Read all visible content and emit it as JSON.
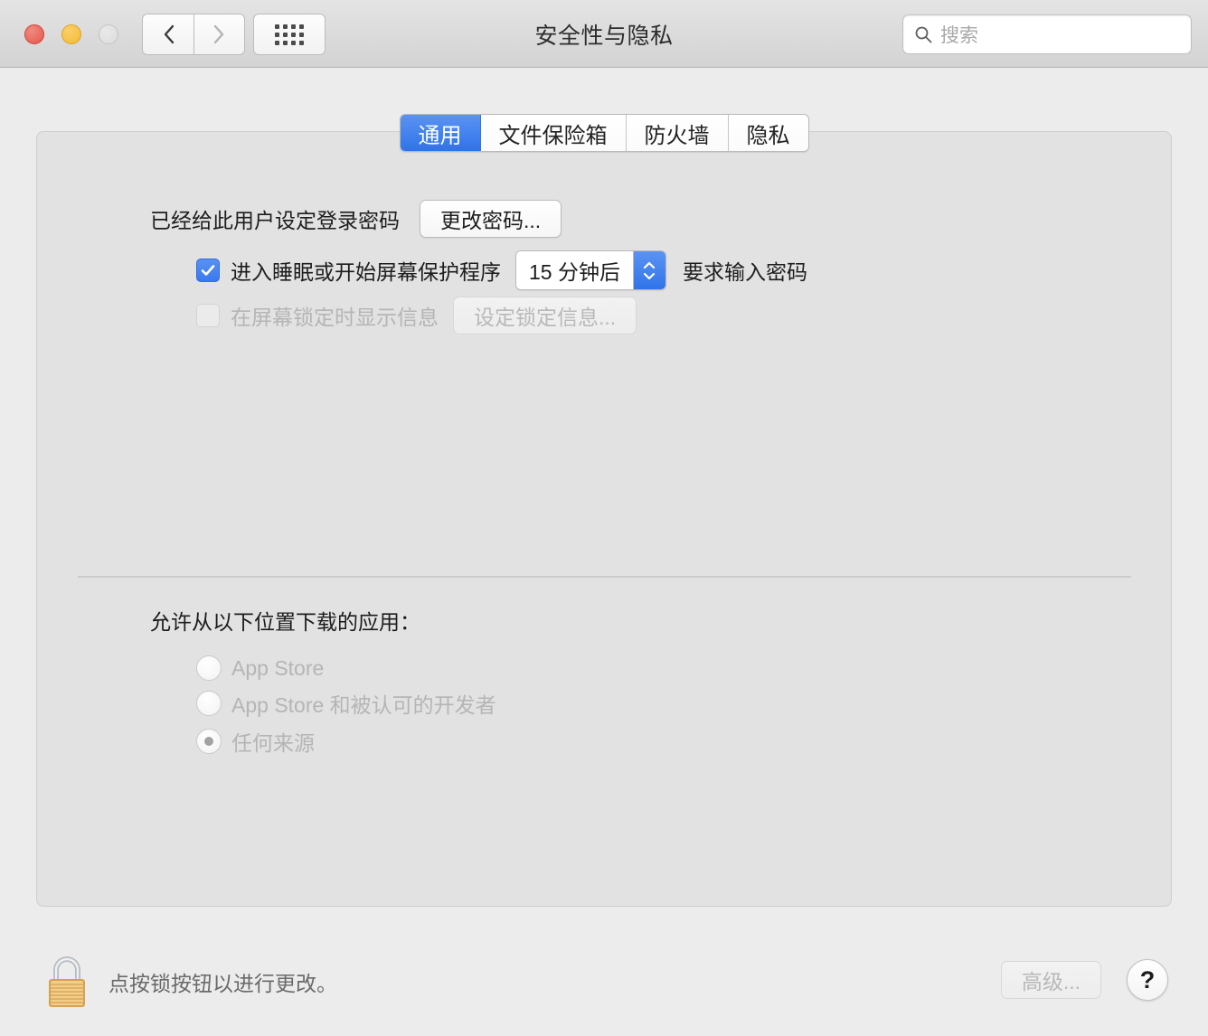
{
  "window": {
    "title": "安全性与隐私",
    "traffic_lights": [
      "close",
      "minimize",
      "zoom"
    ]
  },
  "toolbar": {
    "back_icon": "chevron-left-icon",
    "forward_icon": "chevron-right-icon",
    "show_all_icon": "grid-dots-icon",
    "search": {
      "placeholder": "搜索",
      "value": "",
      "icon": "search-icon"
    }
  },
  "tabs": [
    {
      "label": "通用",
      "active": true
    },
    {
      "label": "文件保险箱",
      "active": false
    },
    {
      "label": "防火墙",
      "active": false
    },
    {
      "label": "隐私",
      "active": false
    }
  ],
  "general": {
    "login_password_label": "已经给此用户设定登录密码",
    "change_password_button": "更改密码...",
    "require_password": {
      "checked": true,
      "prefix_label": "进入睡眠或开始屏幕保护程序",
      "delay_value": "15 分钟后",
      "suffix_label": "要求输入密码"
    },
    "lock_message": {
      "checked": false,
      "label": "在屏幕锁定时显示信息",
      "button": "设定锁定信息...",
      "disabled": true
    },
    "download_sources": {
      "heading": "允许从以下位置下载的应用：",
      "disabled": true,
      "options": [
        {
          "label": "App Store",
          "selected": false
        },
        {
          "label": "App Store 和被认可的开发者",
          "selected": false
        },
        {
          "label": "任何来源",
          "selected": true
        }
      ]
    }
  },
  "bottom_bar": {
    "lock_icon": "padlock-locked-icon",
    "lock_message": "点按锁按钮以进行更改。",
    "advanced_button": "高级...",
    "advanced_disabled": true,
    "help_button": "?"
  },
  "colors": {
    "accent_blue": "#3a78ef",
    "window_bg": "#ececec",
    "panel_bg": "#e2e2e2",
    "close_red": "#e5564b",
    "minimize_yellow": "#f3ba33"
  }
}
